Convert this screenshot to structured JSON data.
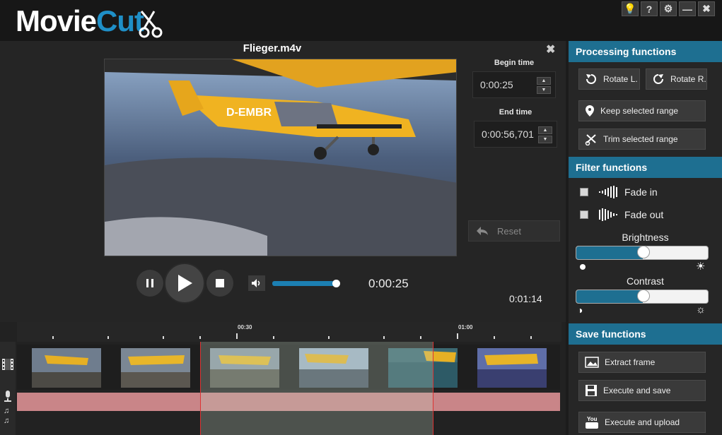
{
  "app": {
    "logo_part1": "Movie",
    "logo_part2": "Cut"
  },
  "window_buttons": [
    {
      "name": "tip-button",
      "icon": "lightbulb-icon",
      "glyph": "💡"
    },
    {
      "name": "help-button",
      "icon": "question-icon",
      "glyph": "?"
    },
    {
      "name": "settings-button",
      "icon": "gear-icon",
      "glyph": "⚙"
    },
    {
      "name": "minimize-button",
      "icon": "minimize-icon",
      "glyph": "—"
    },
    {
      "name": "close-button",
      "icon": "close-icon",
      "glyph": "✖"
    }
  ],
  "preview": {
    "file_name": "Flieger.m4v",
    "begin_time_label": "Begin time",
    "begin_time": "0:00:25",
    "end_time_label": "End time",
    "end_time": "0:00:56,701",
    "reset_label": "Reset",
    "current_time": "0:00:25",
    "total_time": "0:01:14",
    "volume_level": 0.95,
    "video_caption": "D-EMBR"
  },
  "timeline": {
    "markers": [
      "00:30",
      "01:00"
    ],
    "selection_start": "0:00:25",
    "selection_end": "0:00:56,701"
  },
  "sidebar": {
    "processing_title": "Processing functions",
    "rotate_left": "Rotate L.",
    "rotate_right": "Rotate R.",
    "keep_range": "Keep selected range",
    "trim_range": "Trim selected range",
    "filter_title": "Filter functions",
    "fade_in": "Fade in",
    "fade_out": "Fade out",
    "brightness_label": "Brightness",
    "brightness_value": 0.5,
    "contrast_label": "Contrast",
    "contrast_value": 0.5,
    "save_title": "Save functions",
    "extract_frame": "Extract frame",
    "execute_save": "Execute and save",
    "execute_upload": "Execute and upload"
  },
  "colors": {
    "accent": "#1e6f91",
    "logo_blue": "#1f8fc7",
    "audio_track": "#c98588",
    "selection_border": "#dd3333"
  }
}
